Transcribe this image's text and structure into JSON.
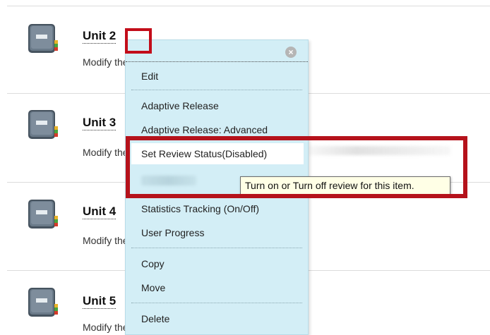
{
  "units": [
    {
      "title": "Unit 2",
      "description": "Modify the items included in this learning module."
    },
    {
      "title": "Unit 3",
      "description": "Modify the items included in this learning module."
    },
    {
      "title": "Unit 4",
      "description": "Modify the items included in this learning module."
    },
    {
      "title": "Unit 5",
      "description": "Modify the items included in this learning module."
    }
  ],
  "menu": {
    "close_icon": "close-icon",
    "items": [
      {
        "label": "Edit"
      },
      {
        "label": "Adaptive Release"
      },
      {
        "label": "Adaptive Release: Advanced"
      },
      {
        "label": "Set Review Status(Disabled)"
      },
      {
        "label": "Statistics Tracking (On/Off)"
      },
      {
        "label": "User Progress"
      },
      {
        "label": "Copy"
      },
      {
        "label": "Move"
      },
      {
        "label": "Delete"
      }
    ]
  },
  "tooltip": {
    "text": "Turn on or Turn off review for this item."
  },
  "colors": {
    "menu_background": "#d3eef6",
    "highlight_border": "#b5121b",
    "tooltip_background": "#ffffe6",
    "book_cover": "#5f6f7e"
  }
}
